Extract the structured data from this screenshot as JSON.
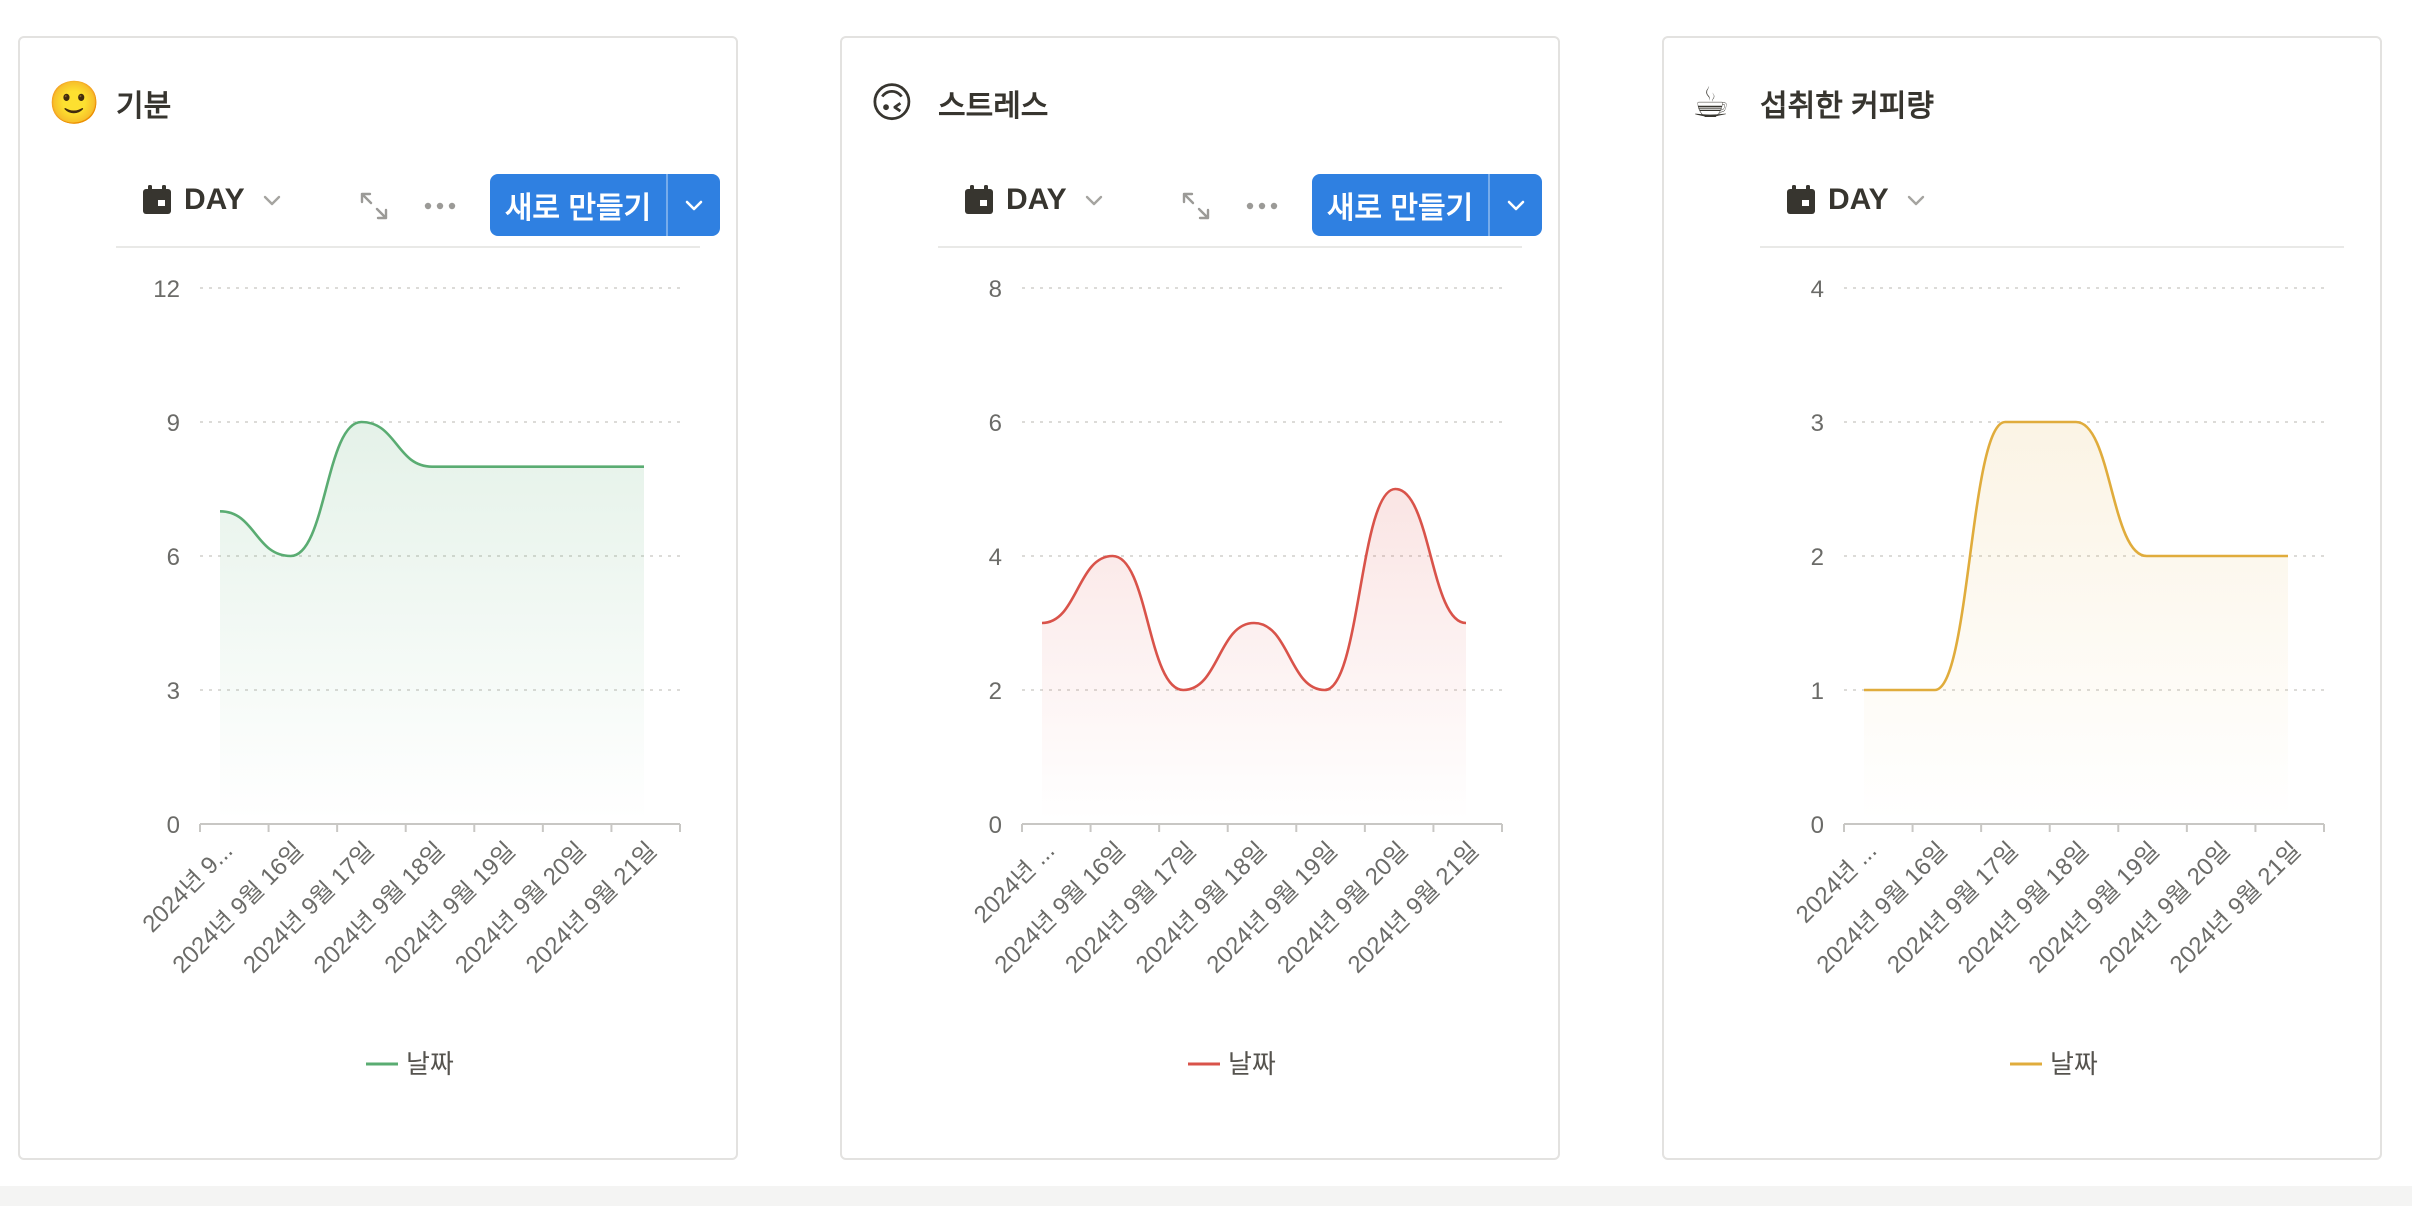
{
  "widgets": [
    {
      "icon": "🙂",
      "icon_name": "slightly-smiling-face-icon",
      "title": "기분",
      "view_label": "DAY",
      "show_actions": true,
      "new_button_label": "새로 만들기",
      "color": "#5aac72",
      "fill": "#5aac72"
    },
    {
      "icon": "🙃",
      "icon_name": "upside-down-face-icon",
      "title": "스트레스",
      "view_label": "DAY",
      "show_actions": true,
      "new_button_label": "새로 만들기",
      "color": "#d9534a",
      "fill": "#e05a55"
    },
    {
      "icon": "☕",
      "icon_name": "coffee-cup-icon",
      "title": "섭취한 커피량",
      "view_label": "DAY",
      "show_actions": false,
      "new_button_label": "",
      "color": "#e0ac3c",
      "fill": "#e6b95a"
    }
  ],
  "chart_data": [
    {
      "type": "line",
      "smooth": true,
      "area_fill": true,
      "categories": [
        "2024년 9...",
        "2024년 9월 16일",
        "2024년 9월 17일",
        "2024년 9월 18일",
        "2024년 9월 19일",
        "2024년 9월 20일",
        "2024년 9월 21일"
      ],
      "series": [
        {
          "name": "날짜",
          "values": [
            7,
            6,
            9,
            8,
            8,
            8,
            8
          ]
        }
      ],
      "ylim": [
        0,
        12
      ],
      "yticks": [
        0,
        3,
        6,
        9,
        12
      ],
      "grid": true,
      "legend": "bottom"
    },
    {
      "type": "line",
      "smooth": true,
      "area_fill": true,
      "categories": [
        "2024년 ...",
        "2024년 9월 16일",
        "2024년 9월 17일",
        "2024년 9월 18일",
        "2024년 9월 19일",
        "2024년 9월 20일",
        "2024년 9월 21일"
      ],
      "series": [
        {
          "name": "날짜",
          "values": [
            3,
            4,
            2,
            3,
            2,
            5,
            3
          ]
        }
      ],
      "ylim": [
        0,
        8
      ],
      "yticks": [
        0,
        2,
        4,
        6,
        8
      ],
      "grid": true,
      "legend": "bottom"
    },
    {
      "type": "line",
      "smooth": true,
      "area_fill": true,
      "categories": [
        "2024년 ...",
        "2024년 9월 16일",
        "2024년 9월 17일",
        "2024년 9월 18일",
        "2024년 9월 19일",
        "2024년 9월 20일",
        "2024년 9월 21일"
      ],
      "series": [
        {
          "name": "날짜",
          "values": [
            1,
            1,
            3,
            3,
            2,
            2,
            2
          ]
        }
      ],
      "ylim": [
        0,
        4
      ],
      "yticks": [
        0,
        1,
        2,
        3,
        4
      ],
      "grid": true,
      "legend": "bottom"
    }
  ]
}
